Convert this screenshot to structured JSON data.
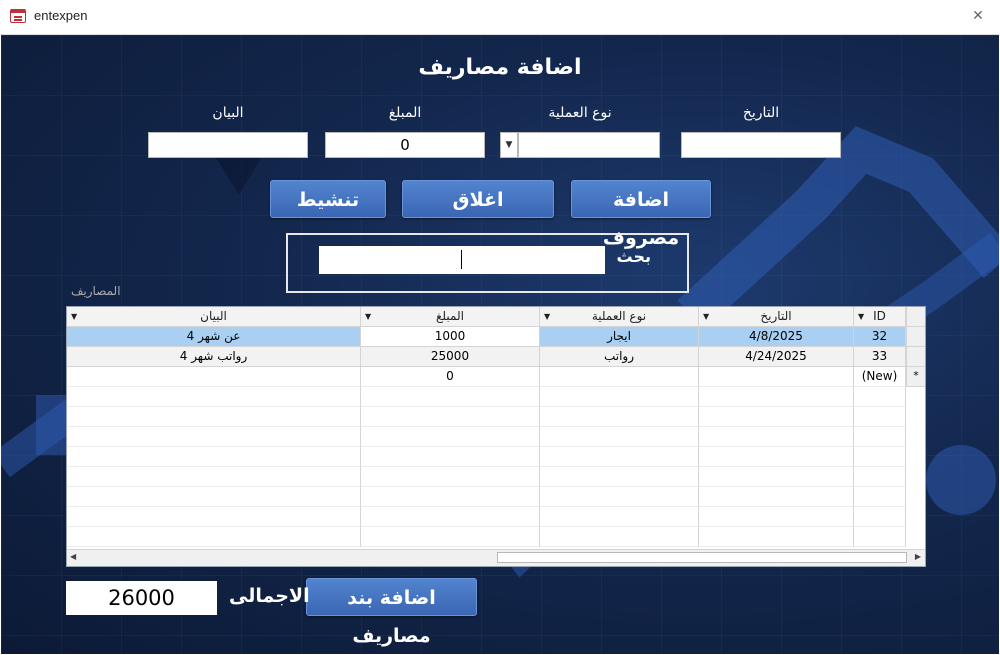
{
  "window": {
    "title": "entexpen",
    "close_glyph": "✕",
    "app_icon": "form-icon"
  },
  "form": {
    "title": "اضافة مصاريف",
    "fields": {
      "date": {
        "label": "التاريخ",
        "value": ""
      },
      "op_type": {
        "label": "نوع العملية",
        "value": ""
      },
      "amount": {
        "label": "المبلغ",
        "value": "0"
      },
      "description": {
        "label": "البيان",
        "value": ""
      }
    },
    "buttons": {
      "add_expense": "اضافة مصروف",
      "close": "اغلاق",
      "refresh": "تنشيط"
    },
    "search": {
      "label": "بحث",
      "value": ""
    }
  },
  "grid": {
    "section_label": "المصاريف",
    "columns": [
      "ID",
      "التاريخ",
      "نوع العملية",
      "المبلغ",
      "البيان"
    ],
    "rows": [
      {
        "id": "32",
        "date": "4/8/2025",
        "type": "ايجار",
        "amount": "1000",
        "desc": "عن شهر 4"
      },
      {
        "id": "33",
        "date": "4/24/2025",
        "type": "رواتب",
        "amount": "25000",
        "desc": "رواتب شهر 4"
      }
    ],
    "new_row": {
      "id": "(New)",
      "amount": "0",
      "marker": "*"
    }
  },
  "footer": {
    "add_item_button": "اضافة بند مصاريف",
    "total_label": "الاجمالى",
    "total_value": "26000"
  },
  "colors": {
    "background": "#13274d",
    "button": "#4674c2",
    "selected_row": "#a9d0f3"
  }
}
